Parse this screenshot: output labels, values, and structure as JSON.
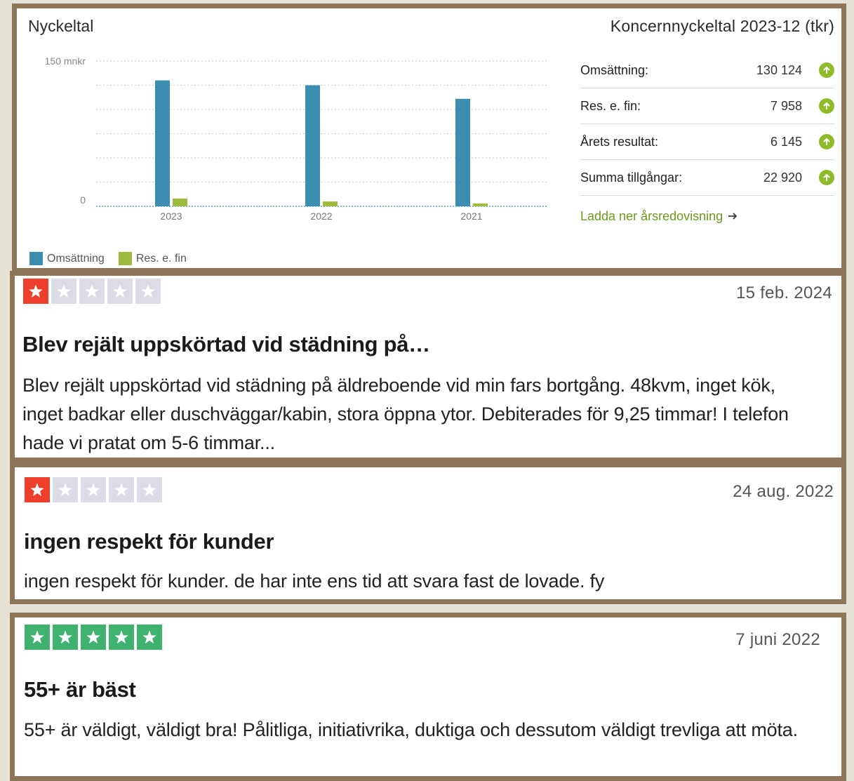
{
  "metrics": {
    "title": "Nyckeltal",
    "group_title": "Koncernnyckeltal 2023-12 (tkr)",
    "rows": [
      {
        "label": "Omsättning:",
        "value": "130 124"
      },
      {
        "label": "Res. e. fin:",
        "value": "7 958"
      },
      {
        "label": "Årets resultat:",
        "value": "6 145"
      },
      {
        "label": "Summa tillgångar:",
        "value": "22 920"
      }
    ],
    "download_label": "Ladda ner årsredovisning",
    "up_icon_color": "#8dbb2a",
    "link_color": "#6b9a1a"
  },
  "chart_data": {
    "type": "bar",
    "categories": [
      "2023",
      "2022",
      "2021"
    ],
    "series": [
      {
        "name": "Omsättning",
        "color": "#3c8daf",
        "values": [
          130,
          125,
          111
        ]
      },
      {
        "name": "Res. e. fin",
        "color": "#9dbb3c",
        "values": [
          8,
          5,
          3
        ]
      }
    ],
    "ytick_labels": [
      "150 mnkr",
      "0"
    ],
    "ylim": [
      0,
      150
    ],
    "grid": true,
    "legend": "bottom-left"
  },
  "reviews": [
    {
      "rating": 1,
      "date": "15 feb. 2024",
      "title": "Blev rejält uppskörtad vid städning på…",
      "body": "Blev rejält uppskörtad vid städning på äldreboende vid min fars bortgång. 48kvm, inget kök, inget badkar eller duschväggar/kabin, stora öppna ytor. Debiterades för 9,25 timmar! I telefon hade vi pratat om 5-6 timmar..."
    },
    {
      "rating": 1,
      "date": "24 aug. 2022",
      "title": "ingen respekt för kunder",
      "body": "ingen respekt för kunder. de har inte ens tid att svara fast de lovade. fy"
    },
    {
      "rating": 5,
      "date": "7 juni 2022",
      "title": "55+ är bäst",
      "body": "55+ är väldigt, väldigt bra! Pålitliga, initiativrika, duktiga och dessutom väldigt trevliga att möta."
    }
  ],
  "star_colors": {
    "one_star": "#ee3f2d",
    "five_star": "#3fb26f",
    "empty": "#dcdce6"
  }
}
